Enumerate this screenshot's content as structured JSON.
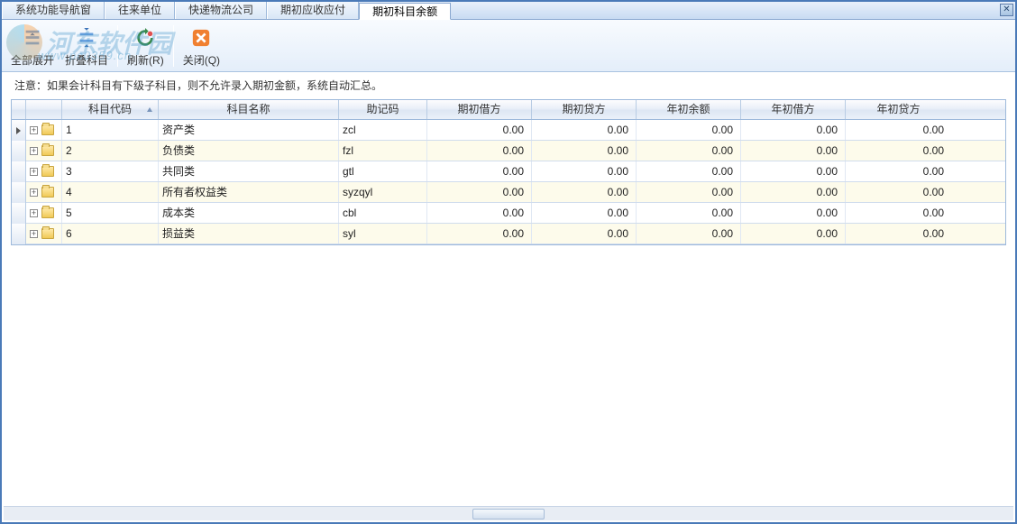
{
  "watermark": {
    "text": "河东软件园",
    "url": "www.pc0359.cn"
  },
  "tabs": [
    {
      "label": "系统功能导航窗",
      "active": false
    },
    {
      "label": "往来单位",
      "active": false
    },
    {
      "label": "快递物流公司",
      "active": false
    },
    {
      "label": "期初应收应付",
      "active": false
    },
    {
      "label": "期初科目余额",
      "active": true
    }
  ],
  "toolbar": {
    "expand": "全部展开",
    "collapse": "折叠科目",
    "refresh": "刷新(R)",
    "close": "关闭(Q)"
  },
  "notice": "注意：如果会计科目有下级子科目，则不允许录入期初金额，系统自动汇总。",
  "columns": {
    "code": "科目代码",
    "name": "科目名称",
    "mnem": "助记码",
    "d1": "期初借方",
    "d2": "期初贷方",
    "d3": "年初余额",
    "d4": "年初借方",
    "d5": "年初贷方"
  },
  "rows": [
    {
      "code": "1",
      "name": "资产类",
      "mnem": "zcl",
      "d1": "0.00",
      "d2": "0.00",
      "d3": "0.00",
      "d4": "0.00",
      "d5": "0.00",
      "sel": true
    },
    {
      "code": "2",
      "name": "负债类",
      "mnem": "fzl",
      "d1": "0.00",
      "d2": "0.00",
      "d3": "0.00",
      "d4": "0.00",
      "d5": "0.00"
    },
    {
      "code": "3",
      "name": "共同类",
      "mnem": "gtl",
      "d1": "0.00",
      "d2": "0.00",
      "d3": "0.00",
      "d4": "0.00",
      "d5": "0.00"
    },
    {
      "code": "4",
      "name": "所有者权益类",
      "mnem": "syzqyl",
      "d1": "0.00",
      "d2": "0.00",
      "d3": "0.00",
      "d4": "0.00",
      "d5": "0.00"
    },
    {
      "code": "5",
      "name": "成本类",
      "mnem": "cbl",
      "d1": "0.00",
      "d2": "0.00",
      "d3": "0.00",
      "d4": "0.00",
      "d5": "0.00"
    },
    {
      "code": "6",
      "name": "损益类",
      "mnem": "syl",
      "d1": "0.00",
      "d2": "0.00",
      "d3": "0.00",
      "d4": "0.00",
      "d5": "0.00"
    }
  ]
}
